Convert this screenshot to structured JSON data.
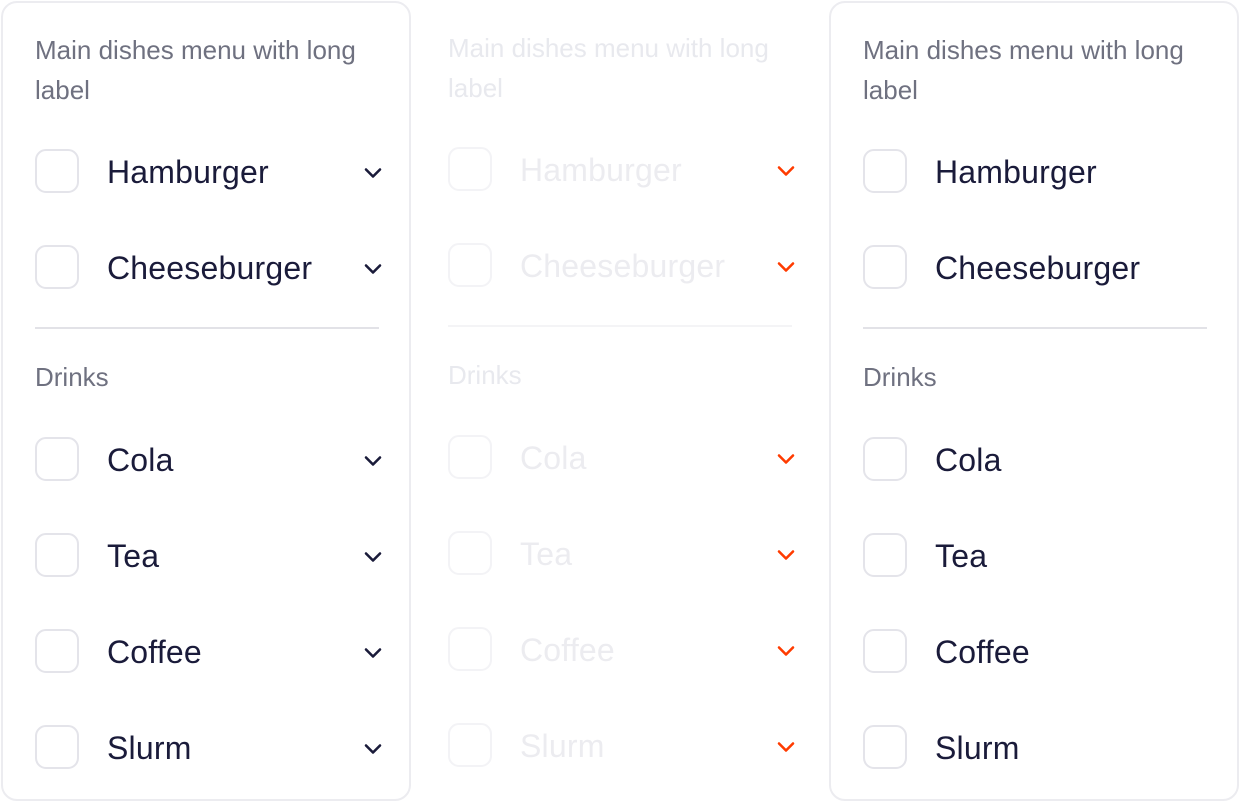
{
  "colors": {
    "text": "#1a1b3a",
    "label": "#6f7180",
    "border": "#e4e4ea",
    "chevron_enabled": "#1a1b3a",
    "chevron_disabled": "#ff3b00"
  },
  "panels": [
    {
      "state": "default",
      "groups": [
        {
          "label": "Main dishes menu with long label",
          "items": [
            "Hamburger",
            "Cheeseburger"
          ]
        },
        {
          "label": "Drinks",
          "items": [
            "Cola",
            "Tea",
            "Coffee",
            "Slurm"
          ]
        }
      ],
      "chevron_icon": "chevron-down-icon"
    },
    {
      "state": "disabled",
      "groups": [
        {
          "label": "Main dishes menu with long label",
          "items": [
            "Hamburger",
            "Cheeseburger"
          ]
        },
        {
          "label": "Drinks",
          "items": [
            "Cola",
            "Tea",
            "Coffee",
            "Slurm"
          ]
        }
      ],
      "chevron_icon": "chevron-down-icon"
    },
    {
      "state": "no-chevron",
      "groups": [
        {
          "label": "Main dishes menu with long label",
          "items": [
            "Hamburger",
            "Cheeseburger"
          ]
        },
        {
          "label": "Drinks",
          "items": [
            "Cola",
            "Tea",
            "Coffee",
            "Slurm"
          ]
        }
      ]
    }
  ]
}
